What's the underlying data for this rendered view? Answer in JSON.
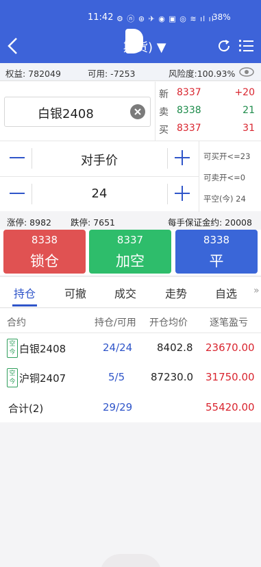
{
  "status_bar": {
    "time": "11:42",
    "icons": "⚙ ⓝ ⊛ ✈ ◉ ▣ ◎ ≋ ıl ıl",
    "battery": "38%"
  },
  "nav": {
    "title": "期货)"
  },
  "account": {
    "equity": "权益: 782049",
    "available": "可用: -7253",
    "risk": "风险度:100.93%"
  },
  "quote": {
    "contract": "白银2408",
    "rows": [
      {
        "label": "新",
        "price": "8337",
        "vol": "+20",
        "price_color": "#d9252f",
        "vol_color": "#d9252f"
      },
      {
        "label": "卖",
        "price": "8338",
        "vol": "21",
        "price_color": "#1d8b4a",
        "vol_color": "#1d8b4a"
      },
      {
        "label": "买",
        "price": "8337",
        "vol": "31",
        "price_color": "#d9252f",
        "vol_color": "#d9252f"
      }
    ]
  },
  "order": {
    "price_mode": "对手价",
    "quantity": "24",
    "info": [
      "可买开<=23",
      "可卖开<=0",
      "平空(今) 24"
    ]
  },
  "limits": {
    "limit_up": "涨停: 8982",
    "limit_down": "跌停: 7651",
    "margin": "每手保证金约: 20008"
  },
  "actions": [
    {
      "price": "8338",
      "label": "锁仓",
      "color": "#e05252"
    },
    {
      "price": "8337",
      "label": "加空",
      "color": "#2ebd6b"
    },
    {
      "price": "8338",
      "label": "平",
      "color": "#3a66d8"
    }
  ],
  "tabs": [
    "持仓",
    "可撤",
    "成交",
    "走势",
    "自选"
  ],
  "tab_more": "»",
  "table": {
    "headers": [
      "合约",
      "持仓/可用",
      "开仓均价",
      "逐笔盈亏"
    ],
    "rows": [
      {
        "badge": "空今",
        "name": "白银2408",
        "hold": "24/24",
        "avg": "8402.8",
        "pnl": "23670.00"
      },
      {
        "badge": "空今",
        "name": "沪铜2407",
        "hold": "5/5",
        "avg": "87230.0",
        "pnl": "31750.00"
      }
    ],
    "total": {
      "name": "合计(2)",
      "hold": "29/29",
      "pnl": "55420.00"
    }
  },
  "colors": {
    "header_blue": "#3d63d9",
    "up_red": "#d9252f",
    "down_green": "#1d8b4a",
    "accent_blue": "#2f55c9"
  }
}
